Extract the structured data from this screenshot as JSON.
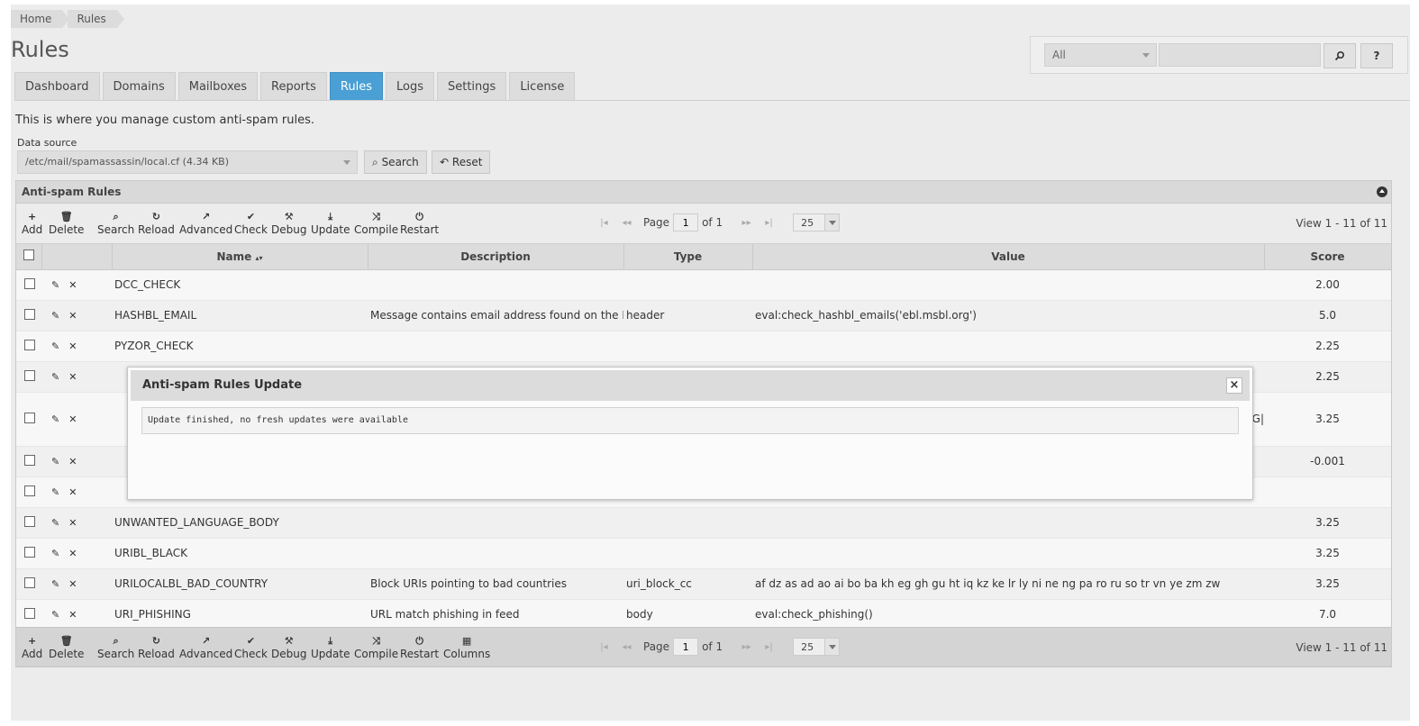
{
  "breadcrumb": [
    "Home",
    "Rules"
  ],
  "page_title": "Rules",
  "search": {
    "scope": "All",
    "query": "",
    "search_icon": "magnifier-icon",
    "help_label": "?"
  },
  "tabs": [
    "Dashboard",
    "Domains",
    "Mailboxes",
    "Reports",
    "Rules",
    "Logs",
    "Settings",
    "License"
  ],
  "active_tab": "Rules",
  "intro": "This is where you manage custom anti-spam rules.",
  "data_source": {
    "label": "Data source",
    "value": "/etc/mail/spamassassin/local.cf (4.34 KB)",
    "search_label": "Search",
    "reset_label": "Reset"
  },
  "grid": {
    "caption": "Anti-spam Rules",
    "toolbar": [
      "Add",
      "Delete",
      "Search",
      "Reload",
      "Advanced",
      "Check",
      "Debug",
      "Update",
      "Compile",
      "Restart"
    ],
    "bottom_toolbar": [
      "Add",
      "Delete",
      "Search",
      "Reload",
      "Advanced",
      "Check",
      "Debug",
      "Update",
      "Compile",
      "Restart",
      "Columns"
    ],
    "pager": {
      "page_label": "Page",
      "page": "1",
      "of_label": "of 1",
      "rows": "25"
    },
    "view_info": "View 1 - 11 of 11",
    "columns": {
      "name": "Name",
      "description": "Description",
      "type": "Type",
      "value": "Value",
      "score": "Score"
    },
    "rows": [
      {
        "name": "DCC_CHECK",
        "description": "",
        "type": "",
        "value": "",
        "score": "2.00"
      },
      {
        "name": "HASHBL_EMAIL",
        "description": "Message contains email address found on the EBL",
        "type": "header",
        "value": "eval:check_hashbl_emails('ebl.msbl.org')",
        "score": "5.0"
      },
      {
        "name": "PYZOR_CHECK",
        "description": "",
        "type": "",
        "value": "",
        "score": "2.25"
      },
      {
        "name": "",
        "description": "",
        "type": "",
        "value": "",
        "score": "2.25"
      },
      {
        "name": "",
        "description": "",
        "type": "",
        "value": "CG|",
        "score": "3.25"
      },
      {
        "name": "",
        "description": "",
        "type": "",
        "value": "",
        "score": "-0.001"
      },
      {
        "name": "",
        "description": "",
        "type": "",
        "value": "",
        "score": ""
      },
      {
        "name": "UNWANTED_LANGUAGE_BODY",
        "description": "",
        "type": "",
        "value": "",
        "score": "3.25"
      },
      {
        "name": "URIBL_BLACK",
        "description": "",
        "type": "",
        "value": "",
        "score": "3.25"
      },
      {
        "name": "URILOCALBL_BAD_COUNTRY",
        "description": "Block URIs pointing to bad countries",
        "type": "uri_block_cc",
        "value": "af dz as ad ao ai bo ba kh eg gh gu ht iq kz ke lr ly ni ne ng pa ro ru so tr vn ye zm zw",
        "score": "3.25"
      },
      {
        "name": "URI_PHISHING",
        "description": "URL match phishing in feed",
        "type": "body",
        "value": "eval:check_phishing()",
        "score": "7.0"
      }
    ]
  },
  "dialog": {
    "title": "Anti-spam Rules Update",
    "message": "Update finished, no fresh updates were available",
    "close_label": "×"
  },
  "colors": {
    "accent": "#4a9fd4",
    "background": "#ececec"
  }
}
